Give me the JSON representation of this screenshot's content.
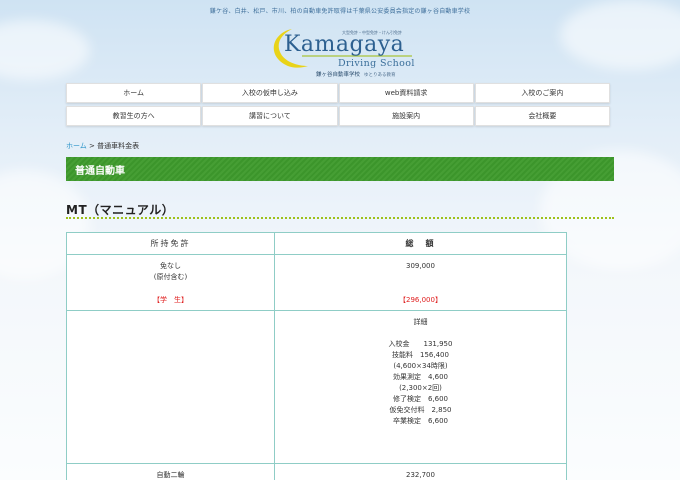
{
  "header": {
    "tagline": "鎌ケ谷、白井、松戸、市川、柏の自動車免許取得は千葉県公安委員会指定の鎌ヶ谷自動車学校",
    "logo": {
      "small_text": "大型免許・中型免許・けん引免許",
      "brand": "Kamagaya",
      "sub": "Driving School",
      "jp_name": "鎌ヶ谷自動車学校",
      "jp_slogan": "ゆとりある教育"
    }
  },
  "nav": {
    "row1": [
      "ホーム",
      "入校の仮申し込み",
      "web資料請求",
      "入校のご案内"
    ],
    "row2": [
      "教習生の方へ",
      "講習について",
      "施設案内",
      "会社概要"
    ]
  },
  "breadcrumb": {
    "home": "ホーム",
    "separator": " > ",
    "current": "普通車料金表"
  },
  "page": {
    "heading": "普通自動車",
    "section_title": "MT（マニュアル）"
  },
  "table": {
    "headers": [
      "所持免許",
      "総　額"
    ],
    "row1": {
      "license_line1": "免なし",
      "license_line2": "(原付含む)",
      "license_student": "【学　生】",
      "total": "309,000",
      "total_student": "【296,000】"
    },
    "detail": {
      "title": "詳細",
      "lines": [
        "入校金　　131,950",
        "技能料　156,400",
        "(4,600×34時限)",
        "効果測定　4,600",
        "(2,300×2回)",
        "修了検定　6,600",
        "仮免交付料　2,850",
        "卒業検定　6,600"
      ]
    },
    "row3": {
      "license": "自動二輪",
      "total": "232,700"
    }
  },
  "colors": {
    "accent_green": "#3e9a2c",
    "dotted_line": "#9ec11a",
    "table_border": "#8fcdc6",
    "student_red": "#e02020",
    "link_blue": "#2a93c8"
  }
}
